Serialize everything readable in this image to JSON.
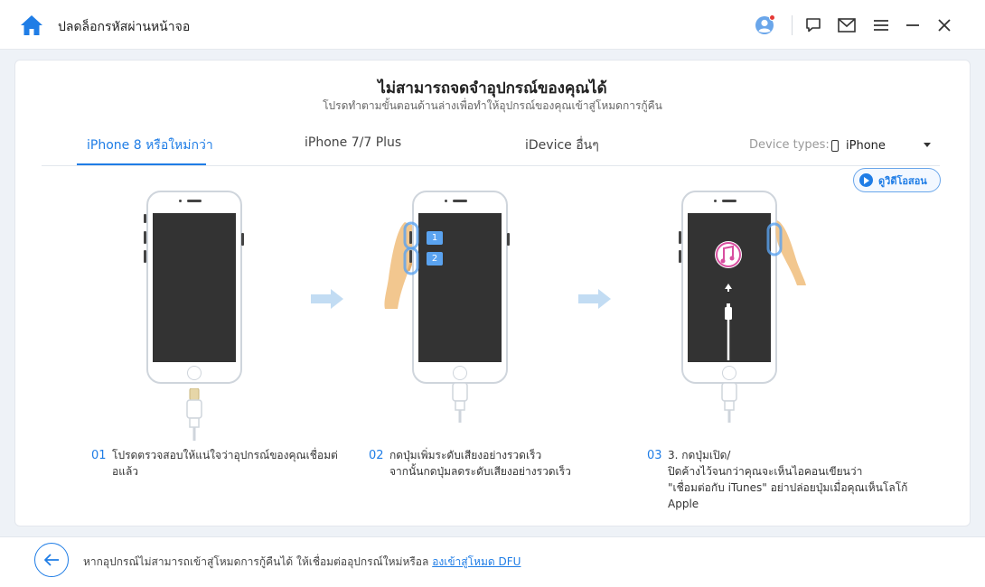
{
  "app": {
    "title": "ปลดล็อกรหัสผ่านหน้าจอ"
  },
  "titlebar": {
    "icons": [
      "home-icon",
      "avatar-icon",
      "feedback-icon",
      "mail-icon",
      "menu-icon",
      "minimize-icon",
      "close-icon"
    ]
  },
  "header": {
    "title": "ไม่สามารถจดจำอุปกรณ์ของคุณได้",
    "subtitle": "โปรดทำตามขั้นตอนด้านล่างเพื่อทำให้อุปกรณ์ของคุณเข้าสู่โหมดการกู้คืน"
  },
  "tabs": [
    {
      "label": "iPhone 8 หรือใหม่กว่า",
      "active": true
    },
    {
      "label": "iPhone 7/7 Plus",
      "active": false
    },
    {
      "label": "iDevice อื่นๆ",
      "active": false
    }
  ],
  "device": {
    "label": "Device types:",
    "value": "iPhone"
  },
  "video_button": {
    "label": "ดูวิดีโอสอน"
  },
  "steps": [
    {
      "num": "01",
      "lines": [
        "โปรดตรวจสอบให้แน่ใจว่าอุปกรณ์ของคุณเชื่อมต่",
        "อแล้ว"
      ]
    },
    {
      "num": "02",
      "lines": [
        "กดปุ่มเพิ่มระดับเสียงอย่างรวดเร็ว",
        "จากนั้นกดปุ่มลดระดับเสียงอย่างรวดเร็ว"
      ]
    },
    {
      "num": "03",
      "lines": [
        "3. กดปุ่มเปิด/",
        "ปิดค้างไว้จนกว่าคุณจะเห็นไอคอนเขียนว่า",
        "\"เชื่อมต่อกับ iTunes\" อย่าปล่อยปุ่มเมื่อคุณเห็นโลโก้",
        "Apple"
      ]
    }
  ],
  "badges": [
    "1",
    "2"
  ],
  "footer": {
    "text": "หากอุปกรณ์ไม่สามารถเข้าสู่โหมดการกู้คืนได้ ให้เชื่อมต่ออุปกรณ์ใหม่หรือล",
    "link": "องเข้าสู่โหมด DFU"
  },
  "colors": {
    "accent": "#1f7de6",
    "screen": "#333333",
    "hand": "#f2c78f"
  }
}
